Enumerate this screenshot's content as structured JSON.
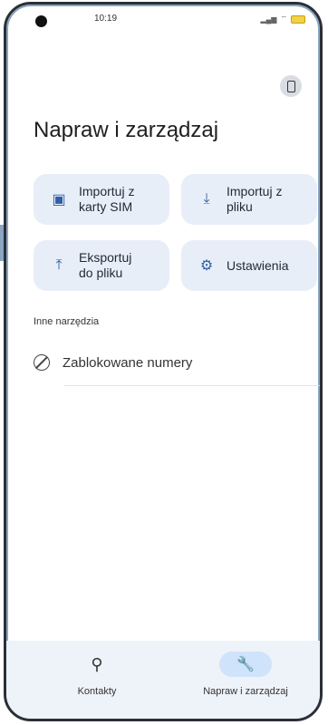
{
  "status": {
    "time": "10:19"
  },
  "header": {
    "title": "Napraw i zarządzaj"
  },
  "tiles": [
    {
      "label": "Importuj z\nkarty SIM",
      "icon": "sim-card-icon"
    },
    {
      "label": "Importuj z\npliku",
      "icon": "download-icon"
    },
    {
      "label": "Eksportuj\ndo pliku",
      "icon": "upload-icon"
    },
    {
      "label": "Ustawienia",
      "icon": "gear-icon"
    }
  ],
  "section": {
    "title": "Inne narzędzia"
  },
  "tools": [
    {
      "label": "Zablokowane numery",
      "icon": "block-icon"
    }
  ],
  "bottom_nav": [
    {
      "label": "Kontakty",
      "icon": "person-icon",
      "active": false
    },
    {
      "label": "Napraw i zarządzaj",
      "icon": "wrench-icon",
      "active": true
    }
  ],
  "colors": {
    "accent": "#2f5fa8",
    "tile_bg": "#e8eef8",
    "active_pill": "#cfe3fb"
  }
}
